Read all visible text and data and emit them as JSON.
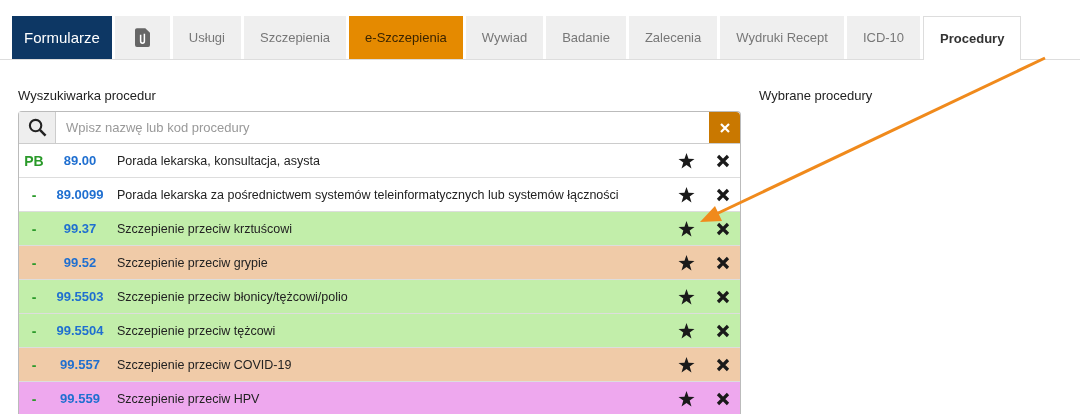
{
  "tabs": [
    {
      "kind": "brand",
      "label": "Formularze",
      "selected": false
    },
    {
      "kind": "icon",
      "selected": false
    },
    {
      "kind": "tab",
      "label": "Usługi",
      "selected": false
    },
    {
      "kind": "tab",
      "label": "Szczepienia",
      "selected": false
    },
    {
      "kind": "accent",
      "label": "e-Szczepienia",
      "selected": false
    },
    {
      "kind": "tab",
      "label": "Wywiad",
      "selected": false
    },
    {
      "kind": "tab",
      "label": "Badanie",
      "selected": false
    },
    {
      "kind": "tab",
      "label": "Zalecenia",
      "selected": false
    },
    {
      "kind": "tab",
      "label": "Wydruki Recept",
      "selected": false
    },
    {
      "kind": "tab",
      "label": "ICD-10",
      "selected": false
    },
    {
      "kind": "tab",
      "label": "Procedury",
      "selected": true
    }
  ],
  "search_panel": {
    "title": "Wyszukiwarka procedur",
    "search": {
      "placeholder": "Wpisz nazwę lub kod procedury"
    },
    "rows": [
      {
        "mark": "PB",
        "code": "89.00",
        "name": "Porada lekarska, konsultacja, asysta",
        "color": "#ffffff"
      },
      {
        "mark": "-",
        "code": "89.0099",
        "name": "Porada lekarska za pośrednictwem systemów teleinformatycznych lub systemów łączności",
        "color": "#ffffff"
      },
      {
        "mark": "-",
        "code": "99.37",
        "name": "Szczepienie przeciw krztuścowi",
        "color": "#c2eeaa"
      },
      {
        "mark": "-",
        "code": "99.52",
        "name": "Szczepienie przeciw grypie",
        "color": "#f0cba8"
      },
      {
        "mark": "-",
        "code": "99.5503",
        "name": "Szczepienie przeciw błonicy/tężcowi/polio",
        "color": "#c2eeaa"
      },
      {
        "mark": "-",
        "code": "99.5504",
        "name": "Szczepienie przeciw tężcowi",
        "color": "#c2eeaa"
      },
      {
        "mark": "-",
        "code": "99.557",
        "name": "Szczepienie przeciw COVID-19",
        "color": "#f0cba8"
      },
      {
        "mark": "-",
        "code": "99.559",
        "name": "Szczepienie przeciw HPV",
        "color": "#eea8ee"
      }
    ]
  },
  "selected_panel": {
    "title": "Wybrane procedury"
  }
}
